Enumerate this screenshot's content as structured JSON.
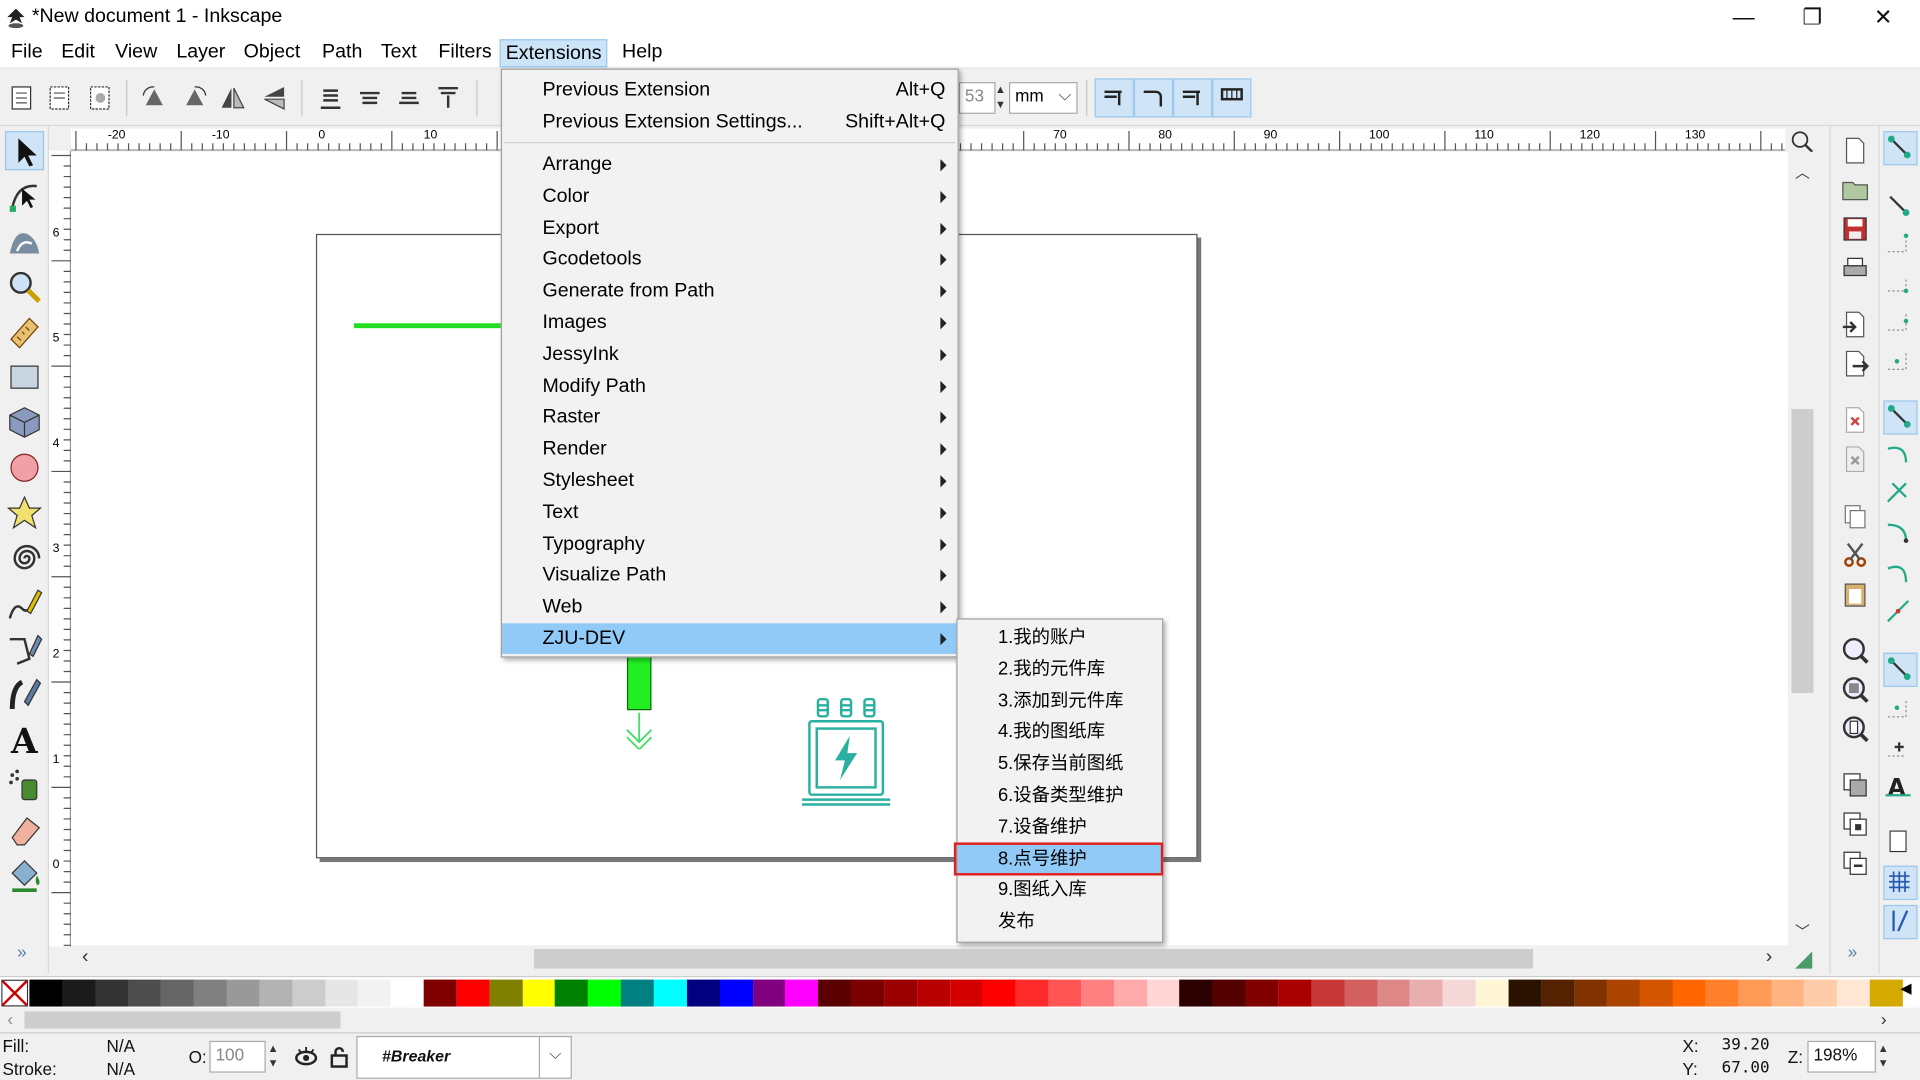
{
  "window": {
    "title": "*New document 1 - Inkscape",
    "controls": {
      "minimize": "—",
      "restore": "❐",
      "close": "✕"
    }
  },
  "menubar": {
    "items": [
      "File",
      "Edit",
      "View",
      "Layer",
      "Object",
      "Path",
      "Text",
      "Filters",
      "Extensions",
      "Help"
    ],
    "active": "Extensions"
  },
  "toolbar": {
    "unit_value": "53",
    "unit": "mm"
  },
  "ruler": {
    "h_labels": [
      "-20",
      "-10",
      "0",
      "10",
      "70",
      "80",
      "90",
      "100",
      "110",
      "120",
      "130"
    ],
    "v_labels": [
      "6",
      "5",
      "4",
      "3",
      "2",
      "1",
      "0"
    ]
  },
  "extensions_menu": {
    "top_items": [
      {
        "label": "Previous Extension",
        "accel": "Alt+Q"
      },
      {
        "label": "Previous Extension Settings...",
        "accel": "Shift+Alt+Q"
      }
    ],
    "submenus": [
      "Arrange",
      "Color",
      "Export",
      "Gcodetools",
      "Generate from Path",
      "Images",
      "JessyInk",
      "Modify Path",
      "Raster",
      "Render",
      "Stylesheet",
      "Text",
      "Typography",
      "Visualize Path",
      "Web",
      "ZJU-DEV"
    ],
    "highlighted": "ZJU-DEV"
  },
  "zju_submenu": {
    "items": [
      "1.我的账户",
      "2.我的元件库",
      "3.添加到元件库",
      "4.我的图纸库",
      "5.保存当前图纸",
      "6.设备类型维护",
      "7.设备维护",
      "8.点号维护",
      "9.图纸入库",
      "发布"
    ],
    "highlighted": "8.点号维护"
  },
  "status": {
    "fill_label": "Fill:",
    "fill_value": "N/A",
    "stroke_label": "Stroke:",
    "stroke_value": "N/A",
    "opacity_label": "O:",
    "opacity_value": "100",
    "layer_name": "#Breaker",
    "x_label": "X:",
    "x_value": "39.20",
    "y_label": "Y:",
    "y_value": "67.00",
    "zoom_label": "Z:",
    "zoom_value": "198%"
  },
  "palette_colors": [
    "#000000",
    "#1a1a1a",
    "#333333",
    "#4d4d4d",
    "#666666",
    "#808080",
    "#999999",
    "#b3b3b3",
    "#cccccc",
    "#e6e6e6",
    "#f2f2f2",
    "#ffffff",
    "#800000",
    "#ff0000",
    "#808000",
    "#ffff00",
    "#008000",
    "#00ff00",
    "#008080",
    "#00ffff",
    "#000080",
    "#0000ff",
    "#800080",
    "#ff00ff",
    "#5a0000",
    "#7a0000",
    "#9a0000",
    "#b80000",
    "#d40000",
    "#ff0000",
    "#ff2a2a",
    "#ff5555",
    "#ff8080",
    "#ffaaaa",
    "#ffd5d5",
    "#2b0000",
    "#550000",
    "#800000",
    "#aa0000",
    "#c83737",
    "#d35f5f",
    "#de8787",
    "#e9afaf",
    "#f4d7d7",
    "#fff6d5",
    "#2b1100",
    "#552200",
    "#803300",
    "#aa4400",
    "#d45500",
    "#ff6600",
    "#ff7f2a",
    "#ff9955",
    "#ffb380",
    "#ffccaa",
    "#ffe6d5",
    "#d4aa00"
  ]
}
